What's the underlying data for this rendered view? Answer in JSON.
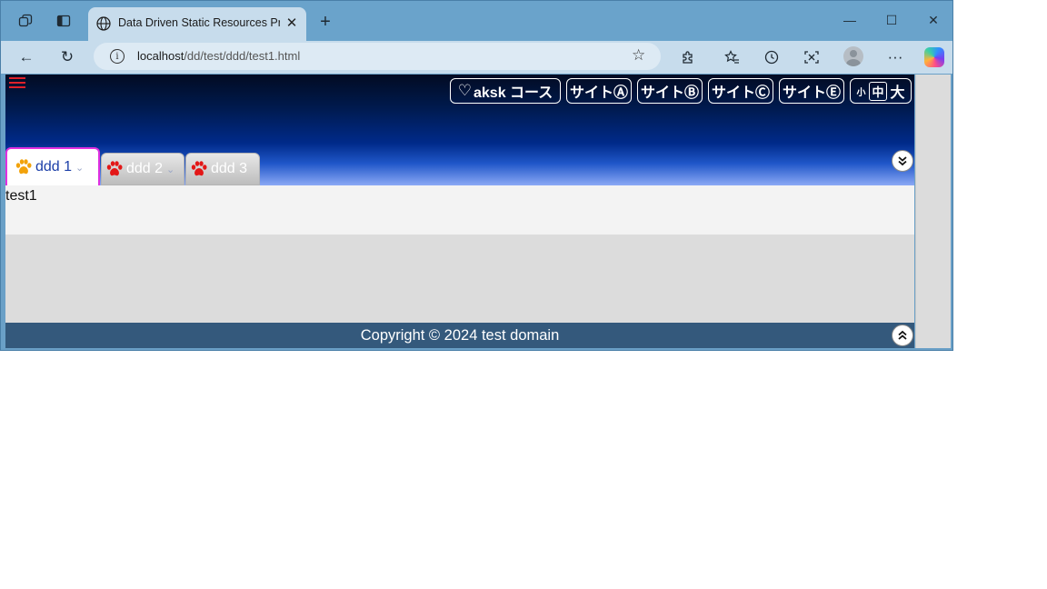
{
  "browser": {
    "tab_title": "Data Driven Static Resources Project",
    "url_host": "localhost",
    "url_path": "/dd/test/ddd/test1.html",
    "new_tab_symbol": "+",
    "close_symbol": "✕",
    "window_controls": {
      "minimize": "—",
      "maximize": "☐",
      "close": "✕"
    },
    "nav_icons": {
      "back": "←",
      "reload": "↻",
      "info": "i",
      "favorite": "☆",
      "more": "···"
    }
  },
  "header": {
    "buttons": [
      "aksk コース",
      "サイトⒶ",
      "サイトⒷ",
      "サイトⒸ",
      "サイトⒺ"
    ],
    "heart": "♡",
    "text_size": {
      "small": "小",
      "medium": "中",
      "large": "大"
    }
  },
  "tabs": [
    {
      "label": "ddd 1",
      "active": true,
      "paw_color": "#f2a20b"
    },
    {
      "label": "ddd 2",
      "active": false,
      "paw_color": "#e31717"
    },
    {
      "label": "ddd 3",
      "active": false,
      "paw_color": "#e31717"
    }
  ],
  "chevron_down": "⌄",
  "content": {
    "text": "test1"
  },
  "footer": {
    "text": "Copyright © 2024 test domain"
  },
  "colors": {
    "accent_tab_border": "#e030e0",
    "footer_bg": "#34597c",
    "menu_icon": "#e0202a"
  }
}
